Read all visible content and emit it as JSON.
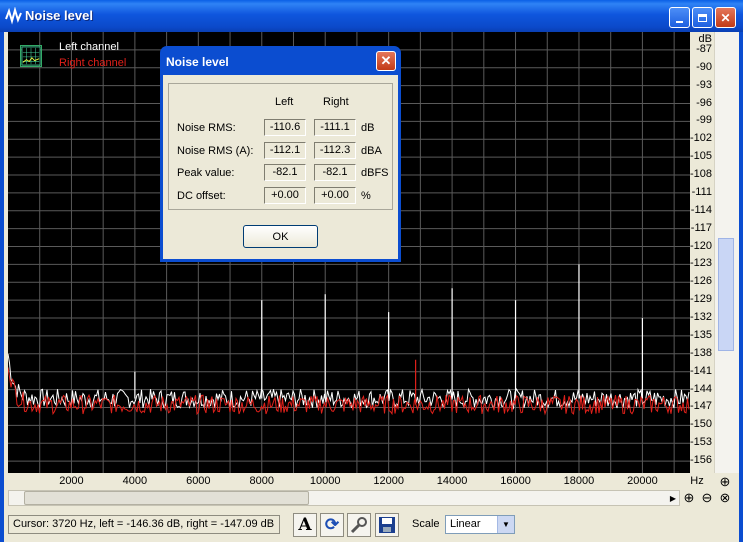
{
  "window": {
    "title": "Noise level",
    "title_icon": "waveform-icon",
    "controls": [
      "minimize-icon",
      "maximize-icon",
      "close-icon"
    ]
  },
  "legend": {
    "left_channel": "Left channel",
    "right_channel": "Right channel",
    "left_color": "#ffffff",
    "right_color": "#e0201a"
  },
  "chart_data": {
    "type": "line",
    "xlabel": "Hz",
    "ylabel": "dB",
    "x_ticks": [
      2000,
      4000,
      6000,
      8000,
      10000,
      12000,
      14000,
      16000,
      18000,
      20000
    ],
    "x_tick_labels": [
      "2000",
      "4000",
      "6000",
      "8000",
      "10000",
      "12000",
      "14000",
      "16000",
      "18000",
      "20000"
    ],
    "xlim": [
      0,
      21500
    ],
    "y_ticks": [
      -87,
      -90,
      -93,
      -96,
      -99,
      -102,
      -105,
      -108,
      -111,
      -114,
      -117,
      -120,
      -123,
      -126,
      -129,
      -132,
      -135,
      -138,
      -141,
      -144,
      -147,
      -150,
      -153,
      -156
    ],
    "y_tick_labels": [
      "-87",
      "-90",
      "-93",
      "-96",
      "-99",
      "-102",
      "-105",
      "-108",
      "-111",
      "-114",
      "-117",
      "-120",
      "-123",
      "-126",
      "-129",
      "-132",
      "-135",
      "-138",
      "-141",
      "-144",
      "-147",
      "-150",
      "-153",
      "-156"
    ],
    "ylim": [
      -158,
      -84
    ],
    "grid": true,
    "background": "#000000",
    "series": [
      {
        "name": "Left channel",
        "color": "#ffffff",
        "floor_db": -145.5,
        "low_freq_start_db": -138,
        "spikes": [
          {
            "x": 4000,
            "y": -141
          },
          {
            "x": 8000,
            "y": -129
          },
          {
            "x": 10000,
            "y": -128
          },
          {
            "x": 12000,
            "y": -131
          },
          {
            "x": 14000,
            "y": -127
          },
          {
            "x": 16000,
            "y": -129
          },
          {
            "x": 18000,
            "y": -123
          },
          {
            "x": 20000,
            "y": -132
          }
        ]
      },
      {
        "name": "Right channel",
        "color": "#e0201a",
        "floor_db": -146.5,
        "low_freq_start_db": -139,
        "spikes": [
          {
            "x": 12850,
            "y": -139
          }
        ]
      }
    ]
  },
  "dialog": {
    "title": "Noise level",
    "col_left": "Left",
    "col_right": "Right",
    "rows": [
      {
        "label": "Noise RMS:",
        "left": "-110.6",
        "right": "-111.1",
        "unit": "dB"
      },
      {
        "label": "Noise RMS (A):",
        "left": "-112.1",
        "right": "-112.3",
        "unit": "dBA"
      },
      {
        "label": "Peak value:",
        "left": "-82.1",
        "right": "-82.1",
        "unit": "dBFS"
      },
      {
        "label": "DC offset:",
        "left": "+0.00",
        "right": "+0.00",
        "unit": "%"
      }
    ],
    "ok_label": "OK"
  },
  "statusbar": {
    "cursor_text": "Cursor:  3720 Hz,  left = -146.36 dB,  right = -147.09 dB",
    "scale_label": "Scale",
    "scale_value": "Linear",
    "tools": [
      "font-icon",
      "refresh-icon",
      "wrench-icon",
      "save-icon"
    ]
  }
}
